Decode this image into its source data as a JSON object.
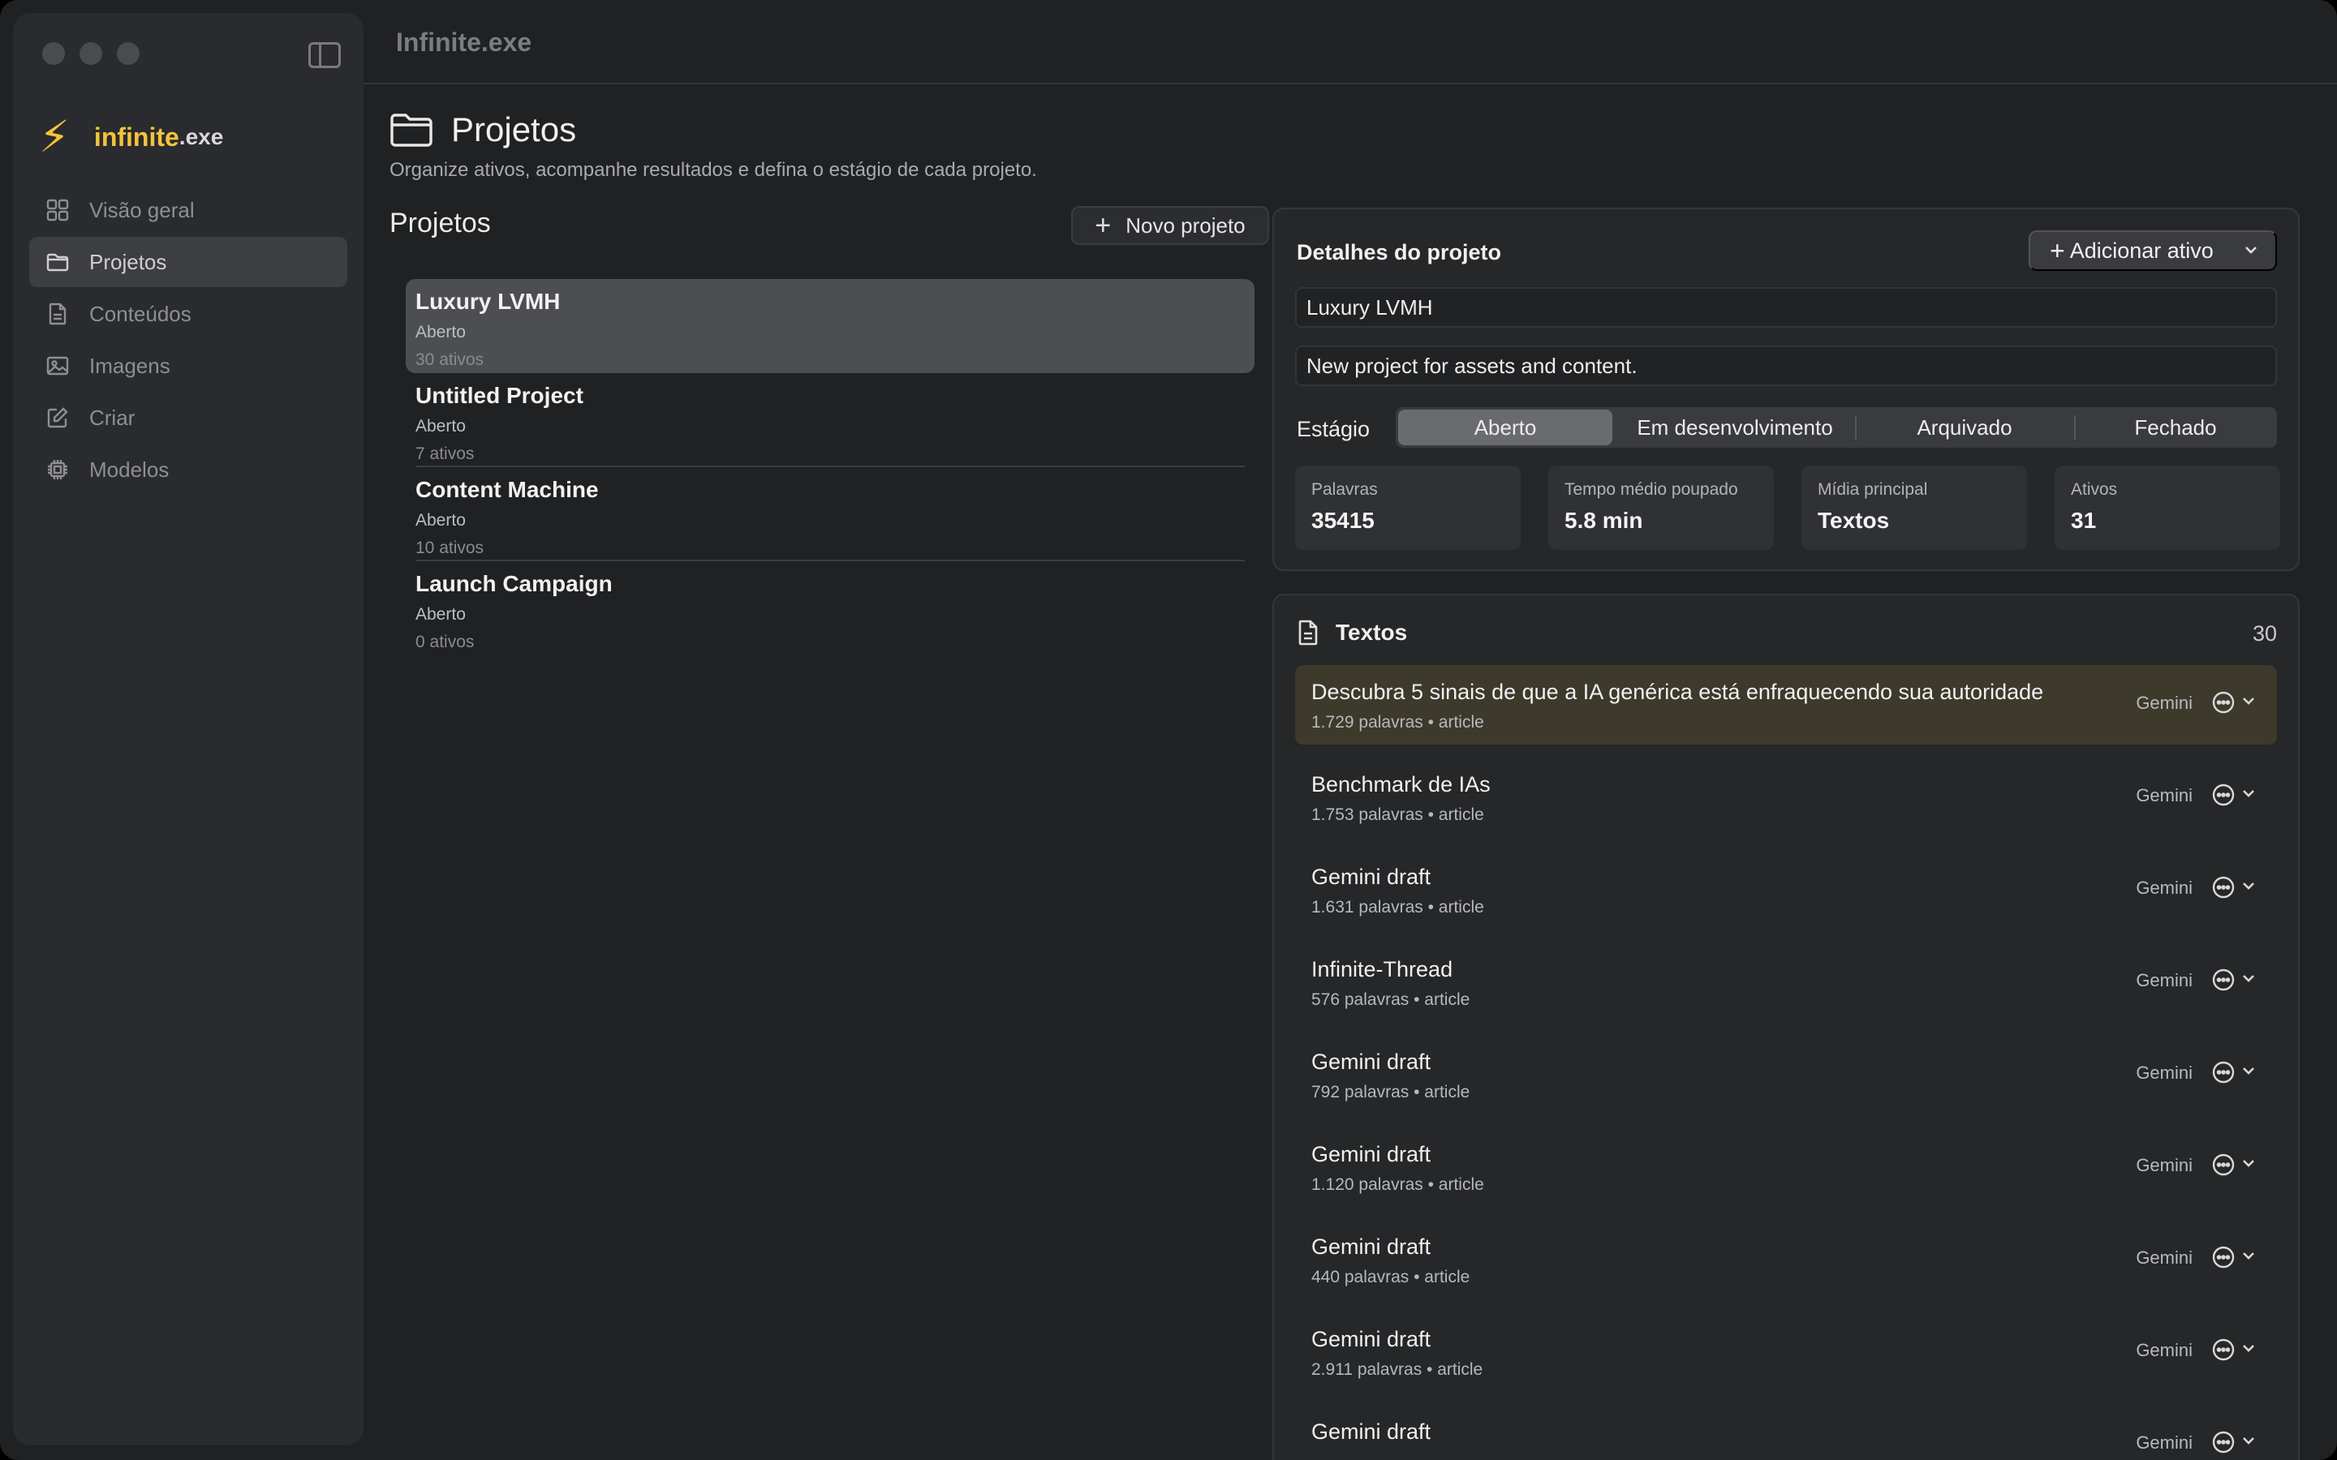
{
  "window": {
    "title": "Infinite.exe"
  },
  "brand": {
    "name": "infinite",
    "ext": ".exe"
  },
  "sidebar": {
    "items": [
      {
        "label": "Visão geral",
        "icon": "grid-icon"
      },
      {
        "label": "Projetos",
        "icon": "folder-icon",
        "active": true
      },
      {
        "label": "Conteúdos",
        "icon": "document-icon"
      },
      {
        "label": "Imagens",
        "icon": "image-icon"
      },
      {
        "label": "Criar",
        "icon": "compose-icon"
      },
      {
        "label": "Modelos",
        "icon": "chip-icon"
      }
    ]
  },
  "page": {
    "title": "Projetos",
    "subtitle": "Organize ativos, acompanhe resultados e defina o estágio de cada projeto."
  },
  "projects": {
    "heading": "Projetos",
    "new_button": "Novo projeto",
    "items": [
      {
        "name": "Luxury LVMH",
        "stage": "Aberto",
        "count": "30 ativos",
        "selected": true
      },
      {
        "name": "Untitled Project",
        "stage": "Aberto",
        "count": "7 ativos"
      },
      {
        "name": "Content Machine",
        "stage": "Aberto",
        "count": "10 ativos"
      },
      {
        "name": "Launch Campaign",
        "stage": "Aberto",
        "count": "0 ativos"
      }
    ]
  },
  "detail": {
    "title": "Detalhes do projeto",
    "add_button": "Adicionar ativo",
    "name_value": "Luxury LVMH",
    "description_value": "New project for assets and content.",
    "stage_label": "Estágio",
    "stages": [
      "Aberto",
      "Em desenvolvimento",
      "Arquivado",
      "Fechado"
    ],
    "active_stage": "Aberto",
    "stats": [
      {
        "label": "Palavras",
        "value": "35415"
      },
      {
        "label": "Tempo médio poupado",
        "value": "5.8 min"
      },
      {
        "label": "Mídia principal",
        "value": "Textos"
      },
      {
        "label": "Ativos",
        "value": "31"
      }
    ]
  },
  "texts": {
    "title": "Textos",
    "count": "30",
    "items": [
      {
        "title": "Descubra 5 sinais de que a IA genérica está enfraquecendo sua autoridade",
        "meta": "1.729 palavras • article",
        "model": "Gemini",
        "highlight": true
      },
      {
        "title": "Benchmark de IAs",
        "meta": "1.753 palavras • article",
        "model": "Gemini"
      },
      {
        "title": "Gemini draft",
        "meta": "1.631 palavras • article",
        "model": "Gemini"
      },
      {
        "title": "Infinite-Thread",
        "meta": "576 palavras • article",
        "model": "Gemini"
      },
      {
        "title": "Gemini draft",
        "meta": "792 palavras • article",
        "model": "Gemini"
      },
      {
        "title": "Gemini draft",
        "meta": "1.120 palavras • article",
        "model": "Gemini"
      },
      {
        "title": "Gemini draft",
        "meta": "440 palavras • article",
        "model": "Gemini"
      },
      {
        "title": "Gemini draft",
        "meta": "2.911 palavras • article",
        "model": "Gemini"
      },
      {
        "title": "Gemini draft",
        "meta": "",
        "model": "Gemini"
      }
    ]
  },
  "colors": {
    "accent": "#f5c33b",
    "highlight_row": "#3d3a2c",
    "background": "#202123"
  }
}
